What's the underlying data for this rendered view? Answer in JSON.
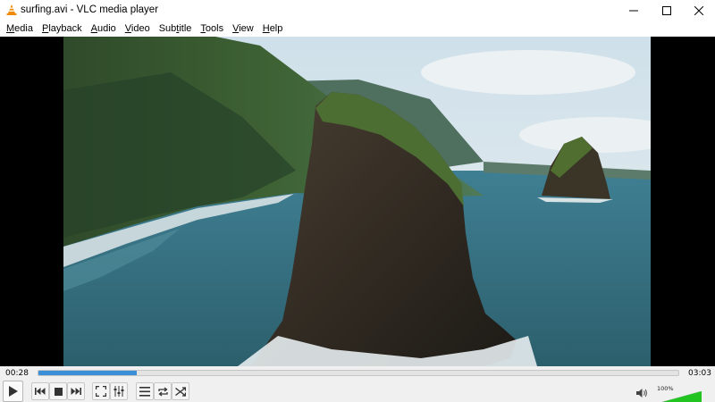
{
  "window": {
    "title": "surfing.avi - VLC media player",
    "minimize_icon": "minimize-icon",
    "maximize_icon": "maximize-icon",
    "close_icon": "close-icon"
  },
  "menu": [
    {
      "accel": "M",
      "rest": "edia"
    },
    {
      "accel": "P",
      "rest": "layback"
    },
    {
      "accel": "A",
      "rest": "udio"
    },
    {
      "accel": "V",
      "rest": "ideo"
    },
    {
      "accel": "",
      "pre": "Sub",
      "accel2": "t",
      "rest": "itle"
    },
    {
      "accel": "T",
      "rest": "ools"
    },
    {
      "accel": "V",
      "rest": "iew"
    },
    {
      "accel": "H",
      "rest": "elp"
    }
  ],
  "playback": {
    "elapsed": "00:28",
    "total": "03:03",
    "progress_fraction": 0.153,
    "volume_label": "100%",
    "volume_fraction": 1.0
  },
  "colors": {
    "seek_fill": "#3b8fd9",
    "volume_fill": "#22c422",
    "vlc_orange": "#f08a00"
  },
  "icons": {
    "play": "play-icon",
    "previous": "skip-previous-icon",
    "stop": "stop-icon",
    "next": "skip-next-icon",
    "fullscreen": "fullscreen-icon",
    "extended_settings": "equalizer-icon",
    "playlist": "playlist-icon",
    "loop": "loop-icon",
    "shuffle": "shuffle-icon",
    "mute": "speaker-icon"
  }
}
